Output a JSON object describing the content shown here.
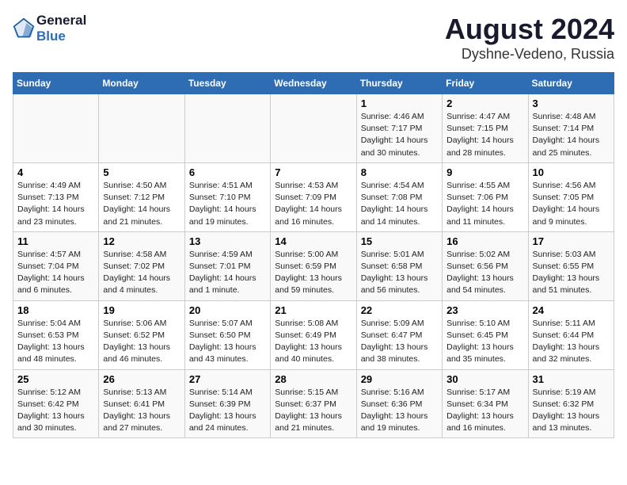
{
  "header": {
    "logo_line1": "General",
    "logo_line2": "Blue",
    "title": "August 2024",
    "subtitle": "Dyshne-Vedeno, Russia"
  },
  "weekdays": [
    "Sunday",
    "Monday",
    "Tuesday",
    "Wednesday",
    "Thursday",
    "Friday",
    "Saturday"
  ],
  "weeks": [
    [
      {
        "day": "",
        "info": ""
      },
      {
        "day": "",
        "info": ""
      },
      {
        "day": "",
        "info": ""
      },
      {
        "day": "",
        "info": ""
      },
      {
        "day": "1",
        "info": "Sunrise: 4:46 AM\nSunset: 7:17 PM\nDaylight: 14 hours\nand 30 minutes."
      },
      {
        "day": "2",
        "info": "Sunrise: 4:47 AM\nSunset: 7:15 PM\nDaylight: 14 hours\nand 28 minutes."
      },
      {
        "day": "3",
        "info": "Sunrise: 4:48 AM\nSunset: 7:14 PM\nDaylight: 14 hours\nand 25 minutes."
      }
    ],
    [
      {
        "day": "4",
        "info": "Sunrise: 4:49 AM\nSunset: 7:13 PM\nDaylight: 14 hours\nand 23 minutes."
      },
      {
        "day": "5",
        "info": "Sunrise: 4:50 AM\nSunset: 7:12 PM\nDaylight: 14 hours\nand 21 minutes."
      },
      {
        "day": "6",
        "info": "Sunrise: 4:51 AM\nSunset: 7:10 PM\nDaylight: 14 hours\nand 19 minutes."
      },
      {
        "day": "7",
        "info": "Sunrise: 4:53 AM\nSunset: 7:09 PM\nDaylight: 14 hours\nand 16 minutes."
      },
      {
        "day": "8",
        "info": "Sunrise: 4:54 AM\nSunset: 7:08 PM\nDaylight: 14 hours\nand 14 minutes."
      },
      {
        "day": "9",
        "info": "Sunrise: 4:55 AM\nSunset: 7:06 PM\nDaylight: 14 hours\nand 11 minutes."
      },
      {
        "day": "10",
        "info": "Sunrise: 4:56 AM\nSunset: 7:05 PM\nDaylight: 14 hours\nand 9 minutes."
      }
    ],
    [
      {
        "day": "11",
        "info": "Sunrise: 4:57 AM\nSunset: 7:04 PM\nDaylight: 14 hours\nand 6 minutes."
      },
      {
        "day": "12",
        "info": "Sunrise: 4:58 AM\nSunset: 7:02 PM\nDaylight: 14 hours\nand 4 minutes."
      },
      {
        "day": "13",
        "info": "Sunrise: 4:59 AM\nSunset: 7:01 PM\nDaylight: 14 hours\nand 1 minute."
      },
      {
        "day": "14",
        "info": "Sunrise: 5:00 AM\nSunset: 6:59 PM\nDaylight: 13 hours\nand 59 minutes."
      },
      {
        "day": "15",
        "info": "Sunrise: 5:01 AM\nSunset: 6:58 PM\nDaylight: 13 hours\nand 56 minutes."
      },
      {
        "day": "16",
        "info": "Sunrise: 5:02 AM\nSunset: 6:56 PM\nDaylight: 13 hours\nand 54 minutes."
      },
      {
        "day": "17",
        "info": "Sunrise: 5:03 AM\nSunset: 6:55 PM\nDaylight: 13 hours\nand 51 minutes."
      }
    ],
    [
      {
        "day": "18",
        "info": "Sunrise: 5:04 AM\nSunset: 6:53 PM\nDaylight: 13 hours\nand 48 minutes."
      },
      {
        "day": "19",
        "info": "Sunrise: 5:06 AM\nSunset: 6:52 PM\nDaylight: 13 hours\nand 46 minutes."
      },
      {
        "day": "20",
        "info": "Sunrise: 5:07 AM\nSunset: 6:50 PM\nDaylight: 13 hours\nand 43 minutes."
      },
      {
        "day": "21",
        "info": "Sunrise: 5:08 AM\nSunset: 6:49 PM\nDaylight: 13 hours\nand 40 minutes."
      },
      {
        "day": "22",
        "info": "Sunrise: 5:09 AM\nSunset: 6:47 PM\nDaylight: 13 hours\nand 38 minutes."
      },
      {
        "day": "23",
        "info": "Sunrise: 5:10 AM\nSunset: 6:45 PM\nDaylight: 13 hours\nand 35 minutes."
      },
      {
        "day": "24",
        "info": "Sunrise: 5:11 AM\nSunset: 6:44 PM\nDaylight: 13 hours\nand 32 minutes."
      }
    ],
    [
      {
        "day": "25",
        "info": "Sunrise: 5:12 AM\nSunset: 6:42 PM\nDaylight: 13 hours\nand 30 minutes."
      },
      {
        "day": "26",
        "info": "Sunrise: 5:13 AM\nSunset: 6:41 PM\nDaylight: 13 hours\nand 27 minutes."
      },
      {
        "day": "27",
        "info": "Sunrise: 5:14 AM\nSunset: 6:39 PM\nDaylight: 13 hours\nand 24 minutes."
      },
      {
        "day": "28",
        "info": "Sunrise: 5:15 AM\nSunset: 6:37 PM\nDaylight: 13 hours\nand 21 minutes."
      },
      {
        "day": "29",
        "info": "Sunrise: 5:16 AM\nSunset: 6:36 PM\nDaylight: 13 hours\nand 19 minutes."
      },
      {
        "day": "30",
        "info": "Sunrise: 5:17 AM\nSunset: 6:34 PM\nDaylight: 13 hours\nand 16 minutes."
      },
      {
        "day": "31",
        "info": "Sunrise: 5:19 AM\nSunset: 6:32 PM\nDaylight: 13 hours\nand 13 minutes."
      }
    ]
  ]
}
